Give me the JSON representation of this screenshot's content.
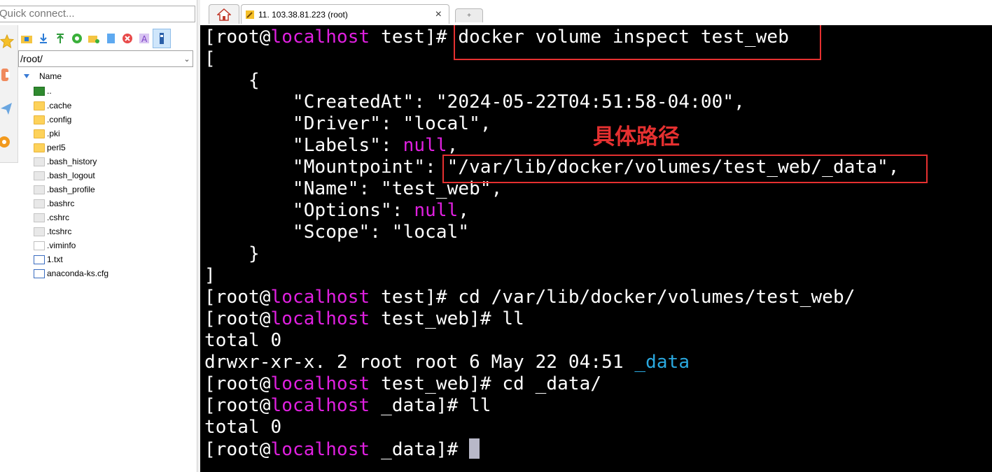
{
  "quick_connect": {
    "placeholder": "Quick connect..."
  },
  "sftp": {
    "path": "/root/",
    "column_name": "Name",
    "files": [
      {
        "name": "..",
        "kind": "up"
      },
      {
        "name": ".cache",
        "kind": "folder"
      },
      {
        "name": ".config",
        "kind": "folder"
      },
      {
        "name": ".pki",
        "kind": "folder"
      },
      {
        "name": "perl5",
        "kind": "folder"
      },
      {
        "name": ".bash_history",
        "kind": "doc"
      },
      {
        "name": ".bash_logout",
        "kind": "doc"
      },
      {
        "name": ".bash_profile",
        "kind": "doc"
      },
      {
        "name": ".bashrc",
        "kind": "doc"
      },
      {
        "name": ".cshrc",
        "kind": "doc"
      },
      {
        "name": ".tcshrc",
        "kind": "doc"
      },
      {
        "name": ".viminfo",
        "kind": "blank"
      },
      {
        "name": "1.txt",
        "kind": "txtdoc"
      },
      {
        "name": "anaconda-ks.cfg",
        "kind": "txtdoc"
      }
    ]
  },
  "tabs": {
    "home_icon": "home-icon",
    "session_label": "11. 103.38.81.223 (root)",
    "close_glyph": "×",
    "new_tab_glyph": "+"
  },
  "terminal": {
    "user": "[root@",
    "host": "localhost",
    "lines": {
      "l1_dir": " test]# ",
      "l1_cmd": "docker volume inspect test_web",
      "l2": "[",
      "l3": "    {",
      "l4": "        \"CreatedAt\": \"2024-05-22T04:51:58-04:00\",",
      "l5": "        \"Driver\": \"local\",",
      "l6_pre": "        \"Labels\": ",
      "l6_null": "null",
      "l6_post": ",",
      "l7": "        \"Mountpoint\": \"/var/lib/docker/volumes/test_web/_data\",",
      "l8": "        \"Name\": \"test_web\",",
      "l9_pre": "        \"Options\": ",
      "l9_null": "null",
      "l9_post": ",",
      "l10": "        \"Scope\": \"local\"",
      "l11": "    }",
      "l12": "]",
      "l13_dir": " test]# ",
      "l13_cmd": "cd /var/lib/docker/volumes/test_web/",
      "l14_dir": " test_web]# ",
      "l14_cmd": "ll",
      "l15": "total 0",
      "l16_pre": "drwxr-xr-x. 2 root root 6 May 22 04:51 ",
      "l16_dir": "_data",
      "l17_dir": " test_web]# ",
      "l17_cmd": "cd _data/",
      "l18_dir": " _data]# ",
      "l18_cmd": "ll",
      "l19": "total 0",
      "l20_dir": " _data]# "
    },
    "annotation": "具体路径",
    "colors": {
      "host": "#e020e0",
      "null": "#e020e0",
      "dir_listing": "#2aa9e0",
      "highlight_box": "#e53030"
    }
  }
}
